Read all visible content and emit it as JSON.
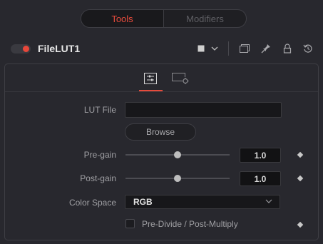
{
  "tabs": [
    {
      "label": "Tools",
      "active": true
    },
    {
      "label": "Modifiers",
      "active": false
    }
  ],
  "header": {
    "node_name": "FileLUT1",
    "enabled": true,
    "icons": [
      "color-swatch-icon",
      "chevron-down-icon",
      "window-icon",
      "pin-icon",
      "lock-icon",
      "reset-icon"
    ]
  },
  "panel_tabs": [
    {
      "icon": "controls-icon",
      "active": true
    },
    {
      "icon": "settings-icon",
      "active": false
    }
  ],
  "controls": {
    "lut_file": {
      "label": "LUT File",
      "value": ""
    },
    "browse_label": "Browse",
    "pre_gain": {
      "label": "Pre-gain",
      "value": "1.0",
      "slider_fraction": 0.5
    },
    "post_gain": {
      "label": "Post-gain",
      "value": "1.0",
      "slider_fraction": 0.5
    },
    "color_space": {
      "label": "Color Space",
      "value": "RGB"
    },
    "pre_divide": {
      "label": "Pre-Divide / Post-Multiply",
      "checked": false
    }
  },
  "colors": {
    "accent": "#e64b3c",
    "background": "#28282e"
  }
}
